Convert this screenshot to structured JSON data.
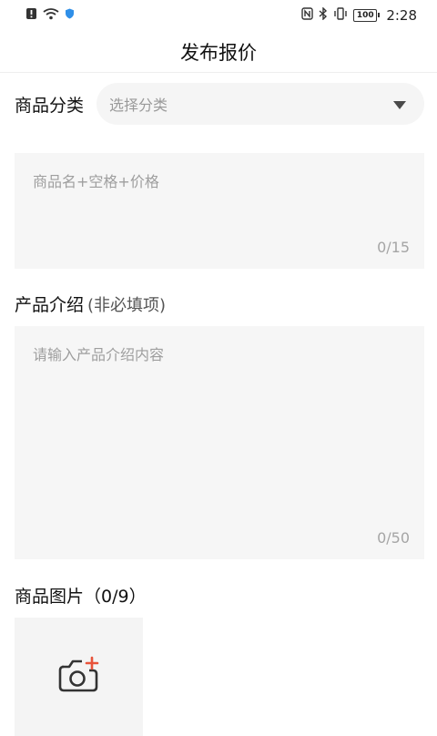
{
  "status_bar": {
    "time": "2:28",
    "battery": "100",
    "icons": [
      "alert-icon",
      "wifi-icon",
      "shield-icon",
      "nfc-icon",
      "bluetooth-icon",
      "vibrate-icon",
      "battery-icon"
    ]
  },
  "header": {
    "title": "发布报价"
  },
  "category": {
    "label": "商品分类",
    "placeholder": "选择分类"
  },
  "name_field": {
    "placeholder": "商品名+空格+价格",
    "counter": "0/15"
  },
  "intro": {
    "label": "产品介绍",
    "hint": "(非必填项)",
    "placeholder": "请输入产品介绍内容",
    "counter": "0/50"
  },
  "images": {
    "label": "商品图片（0/9）"
  },
  "colors": {
    "accent": "#e8533a",
    "field_bg": "#f6f6f6",
    "placeholder": "#9e9e9e"
  }
}
